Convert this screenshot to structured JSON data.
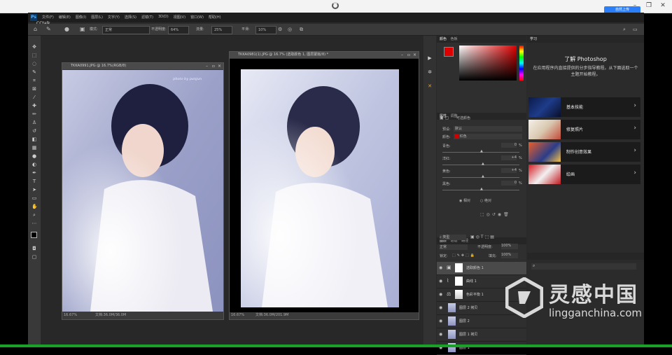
{
  "host": {
    "upload_button": "自然上传"
  },
  "menubar": {
    "logo": "Ps",
    "items": [
      "文件(F)",
      "编辑(E)",
      "图像(I)",
      "图层(L)",
      "文字(Y)",
      "选择(S)",
      "滤镜(T)",
      "3D(D)",
      "视图(V)",
      "窗口(W)",
      "帮助(H)"
    ]
  },
  "overlay": {
    "cctalk": "CCtalk"
  },
  "options": {
    "mode_label": "模式:",
    "mode_value": "正常",
    "opacity_label": "不透明度:",
    "opacity_value": "64%",
    "flow_label": "流量:",
    "flow_value": "25%",
    "smooth_label": "平滑:",
    "smooth_value": "10%"
  },
  "doc1": {
    "title": "TKKA0991.JPG @ 16.7%(RGB/8)",
    "zoom": "16.67%",
    "docsize": "文档:36.0M/36.0M",
    "signature": "photo by panjun"
  },
  "doc2": {
    "title": "TKKA0981(1).JPG @ 16.7% (选取颜色 1, 图层蒙版/8) *",
    "zoom": "16.67%",
    "docsize": "文档:36.0M/201.9M"
  },
  "color_panel": {
    "tabs": [
      "颜色",
      "色板"
    ]
  },
  "props_panel": {
    "tabs": [
      "属性",
      "调整"
    ],
    "title": "可选颜色",
    "preset_label": "预设:",
    "preset_value": "默认",
    "colors_label": "颜色:",
    "colors_value": "红色",
    "cyan_label": "青色:",
    "cyan_value": "0",
    "magenta_label": "洋红:",
    "magenta_value": "+4",
    "yellow_label": "黄色:",
    "yellow_value": "+4",
    "black_label": "黑色:",
    "black_value": "0",
    "pct": "%",
    "relative": "相对",
    "absolute": "绝对"
  },
  "layers_panel": {
    "tabs": [
      "图层",
      "通道",
      "路径"
    ],
    "kind": "类型",
    "blend": "正常",
    "opacity_label": "不透明度:",
    "opacity_value": "100%",
    "lock_label": "锁定:",
    "fill_label": "填充:",
    "fill_value": "100%",
    "layers": [
      {
        "name": "选取颜色 1"
      },
      {
        "name": "曲线 1"
      },
      {
        "name": "色彩平衡 1"
      },
      {
        "name": "图层 2 拷贝"
      },
      {
        "name": "图层 2"
      },
      {
        "name": "图层 1 拷贝"
      },
      {
        "name": "图层 1"
      }
    ]
  },
  "learn_panel": {
    "tab": "学习",
    "heading": "了解 Photoshop",
    "desc": "在应用程序内直接提供的分步指导教程。从下面选取一个主题开始教程。",
    "cards": [
      {
        "title": "基本技能"
      },
      {
        "title": "修复照片"
      },
      {
        "title": "制作创意效果"
      },
      {
        "title": "绘画"
      }
    ]
  },
  "watermark": {
    "brand": "灵感中国",
    "url": "lingganchina.com"
  },
  "colors": {
    "accent": "#2d7ff9",
    "menubar": "#1e1e1e",
    "panel": "#2f2f2f",
    "selected_color": "#cc0000",
    "watermark": "#d9d9d9"
  }
}
